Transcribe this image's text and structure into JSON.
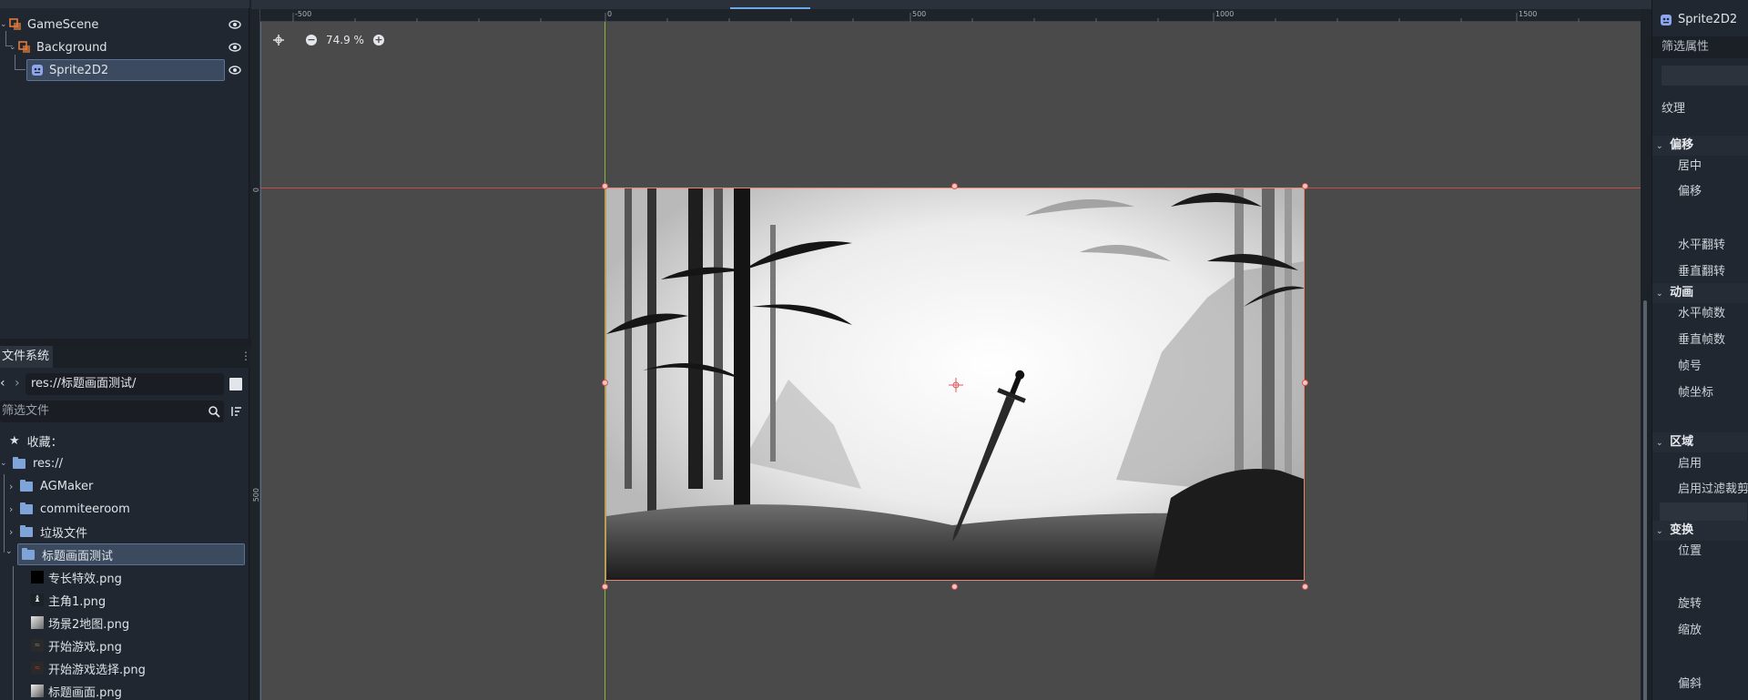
{
  "scene_tree": {
    "nodes": [
      {
        "label": "GameScene",
        "icon": "node2d-icon"
      },
      {
        "label": "Background",
        "icon": "node2d-icon"
      },
      {
        "label": "Sprite2D2",
        "icon": "sprite2d-icon"
      }
    ]
  },
  "filesystem": {
    "tab_label": "文件系统",
    "path": "res://标题画面测试/",
    "filter_placeholder": "筛选文件",
    "favorites_label": "收藏：",
    "root_label": "res://",
    "folders": [
      "AGMaker",
      "commiteeroom",
      "垃圾文件",
      "标题画面测试"
    ],
    "files": [
      "专长特效.png",
      "主角1.png",
      "场景2地图.png",
      "开始游戏.png",
      "开始游戏选择.png",
      "标题画面.png"
    ]
  },
  "viewport": {
    "zoom_level": "74.9 %",
    "ruler_top_labels": [
      "-500",
      "0",
      "500",
      "1000",
      "1500"
    ],
    "ruler_left_labels": [
      "0",
      "500"
    ]
  },
  "inspector": {
    "node_name": "Sprite2D2",
    "filter_label": "筛选属性",
    "rows": {
      "texture": "纹理",
      "offset_section": "偏移",
      "centered": "居中",
      "offset": "偏移",
      "flip_h": "水平翻转",
      "flip_v": "垂直翻转",
      "animation_section": "动画",
      "hframes": "水平帧数",
      "vframes": "垂直帧数",
      "frame": "帧号",
      "frame_coords": "帧坐标",
      "region_section": "区域",
      "region_enabled": "启用",
      "region_filter_clip": "启用过滤裁剪",
      "transform_section": "变换",
      "position": "位置",
      "rotation": "旋转",
      "scale": "缩放",
      "skew": "偏斜"
    }
  },
  "colors": {
    "accent": "#6fa8e8",
    "selection": "#3b4a5e",
    "axis_x": "#c0504d",
    "axis_y": "#8ab43c",
    "sprite_border": "#e8866e"
  }
}
